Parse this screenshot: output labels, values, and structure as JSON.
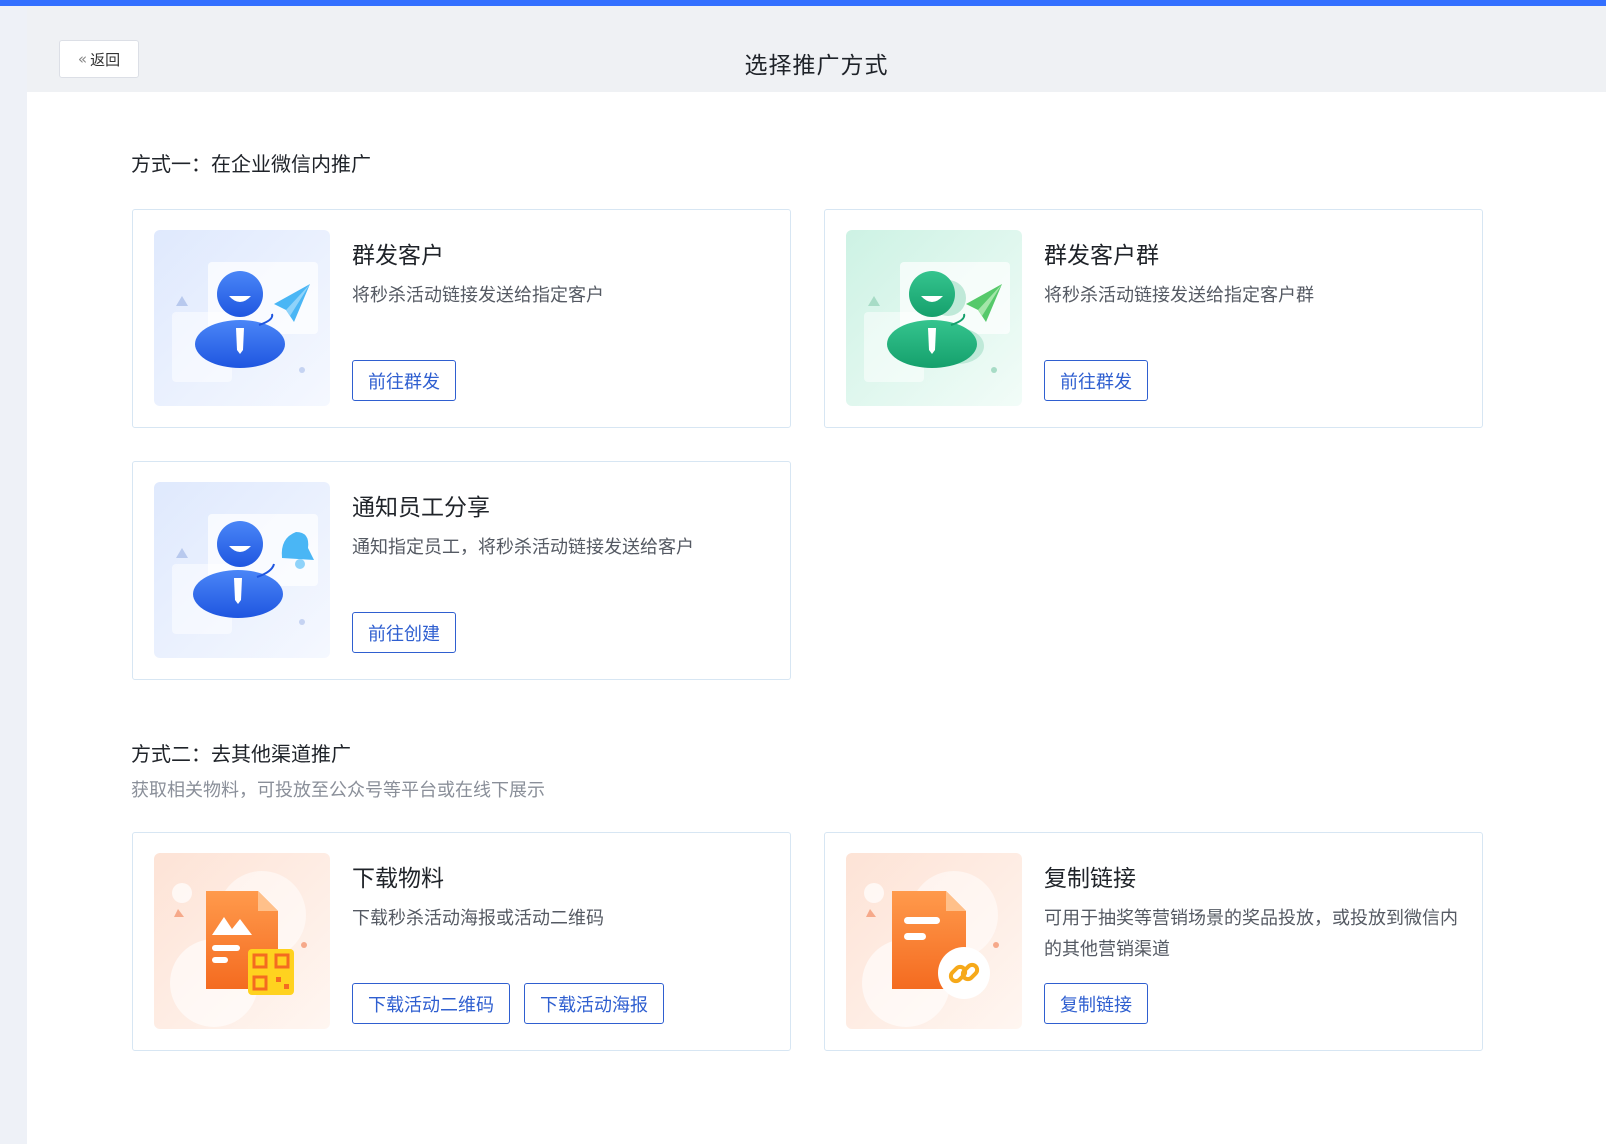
{
  "header": {
    "back_label": "返回",
    "title": "选择推广方式"
  },
  "section1": {
    "title": "方式一：在企业微信内推广",
    "cards": [
      {
        "title": "群发客户",
        "desc": "将秒杀活动链接发送给指定客户",
        "button": "前往群发",
        "icon": "person-paper-plane-icon"
      },
      {
        "title": "群发客户群",
        "desc": "将秒杀活动链接发送给指定客户群",
        "button": "前往群发",
        "icon": "group-paper-plane-icon"
      },
      {
        "title": "通知员工分享",
        "desc": "通知指定员工，将秒杀活动链接发送给客户",
        "button": "前往创建",
        "icon": "person-bell-icon"
      }
    ]
  },
  "section2": {
    "title": "方式二：去其他渠道推广",
    "subtitle": "获取相关物料，可投放至公众号等平台或在线下展示",
    "cards": [
      {
        "title": "下载物料",
        "desc": "下载秒杀活动海报或活动二维码",
        "buttons": [
          "下载活动二维码",
          "下载活动海报"
        ],
        "icon": "document-qrcode-icon"
      },
      {
        "title": "复制链接",
        "desc": "可用于抽奖等营销场景的奖品投放，或投放到微信内的其他营销渠道",
        "button": "复制链接",
        "icon": "document-link-icon"
      }
    ]
  },
  "colors": {
    "accent": "#3370ff",
    "button_border": "#2f5fd0",
    "card_border": "#d7e6f3"
  }
}
